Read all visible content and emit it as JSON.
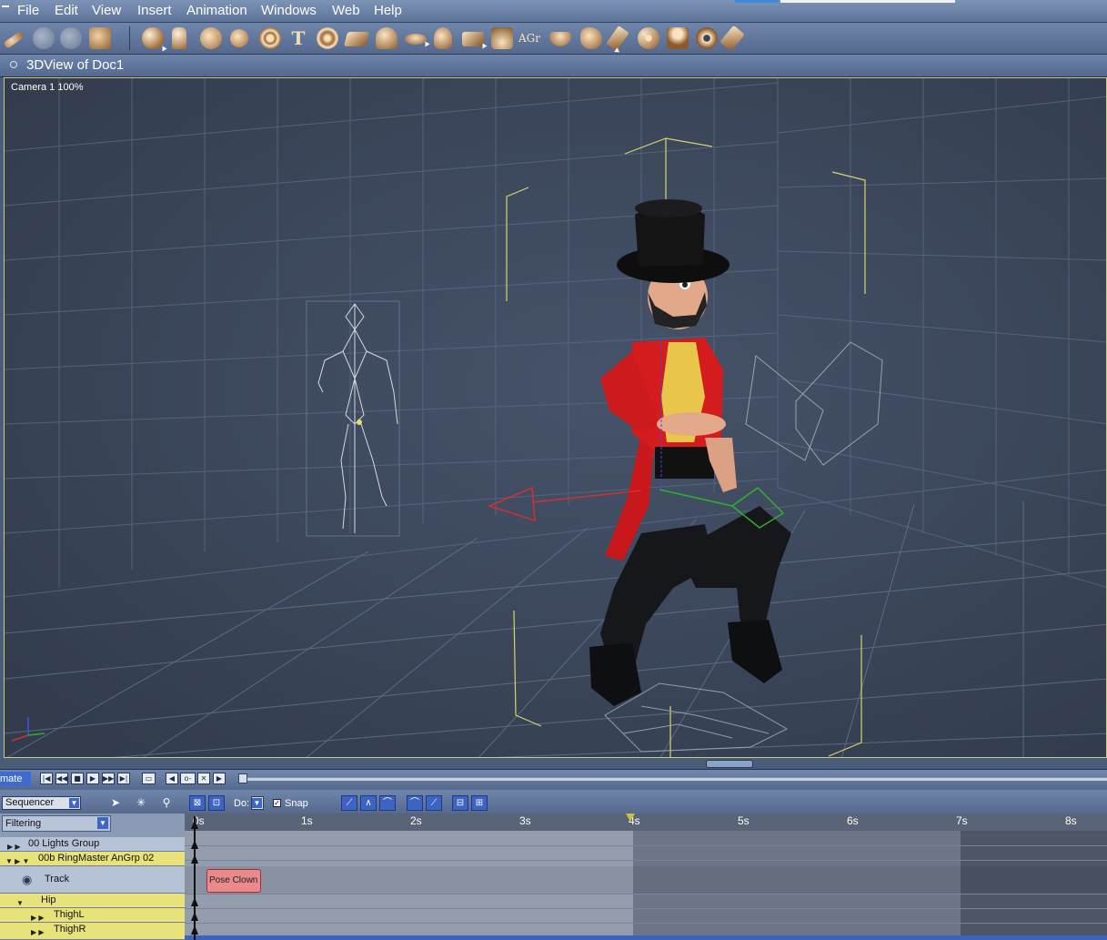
{
  "menu": {
    "items": [
      "File",
      "Edit",
      "View",
      "Insert",
      "Animation",
      "Windows",
      "Web",
      "Help"
    ]
  },
  "toolbar": {
    "tools": [
      "joint-editor-icon",
      "hand-icon",
      "grab-icon",
      "paint-icon",
      "sphere-icon",
      "figure-icon",
      "globe-icon",
      "deformer-icon",
      "target-icon",
      "text-icon",
      "particle-icon",
      "terrain-icon",
      "tree-icon",
      "hair-icon",
      "cloth-icon",
      "ground-icon",
      "grass-icon",
      "ag-icon",
      "bowl-icon",
      "rock-icon",
      "brush-icon",
      "fx-icon",
      "bones-icon",
      "eye-icon",
      "wrench-icon"
    ],
    "ag_label": "AGr"
  },
  "view": {
    "title": "3DView of Doc1",
    "camera_label": "Camera 1 100%"
  },
  "transport": {
    "anim_label": "mate",
    "buttons": [
      "|◀",
      "◀◀",
      "■",
      "▶",
      "▶▶",
      "▶|"
    ]
  },
  "sequencer": {
    "mode": "Sequencer",
    "do_label": "Do:",
    "snap_label": "Snap",
    "snap_checked": true,
    "filter_label": "Filtering",
    "rows": [
      {
        "label": "00 Lights Group",
        "bg": "#b6c2d6"
      },
      {
        "label": "00b RingMaster AnGrp 02",
        "bg": "#e8e27a"
      },
      {
        "label": "Track",
        "bg": "#b6c2d6"
      },
      {
        "label": "Hip",
        "bg": "#e8e27a"
      },
      {
        "label": "ThighL",
        "bg": "#e8e27a"
      },
      {
        "label": "ThighR",
        "bg": "#e8e27a"
      }
    ],
    "ruler_ticks": [
      "0s",
      "1s",
      "2s",
      "3s",
      "4s",
      "5s",
      "6s",
      "7s",
      "8s"
    ],
    "clip_label": "Pose Clown F"
  },
  "colors": {
    "menu_bg": "#6a81a7",
    "viewport_bg": "#3b4658",
    "highlight_row": "#e8e27a",
    "clip_fill": "#ea8a8a"
  }
}
